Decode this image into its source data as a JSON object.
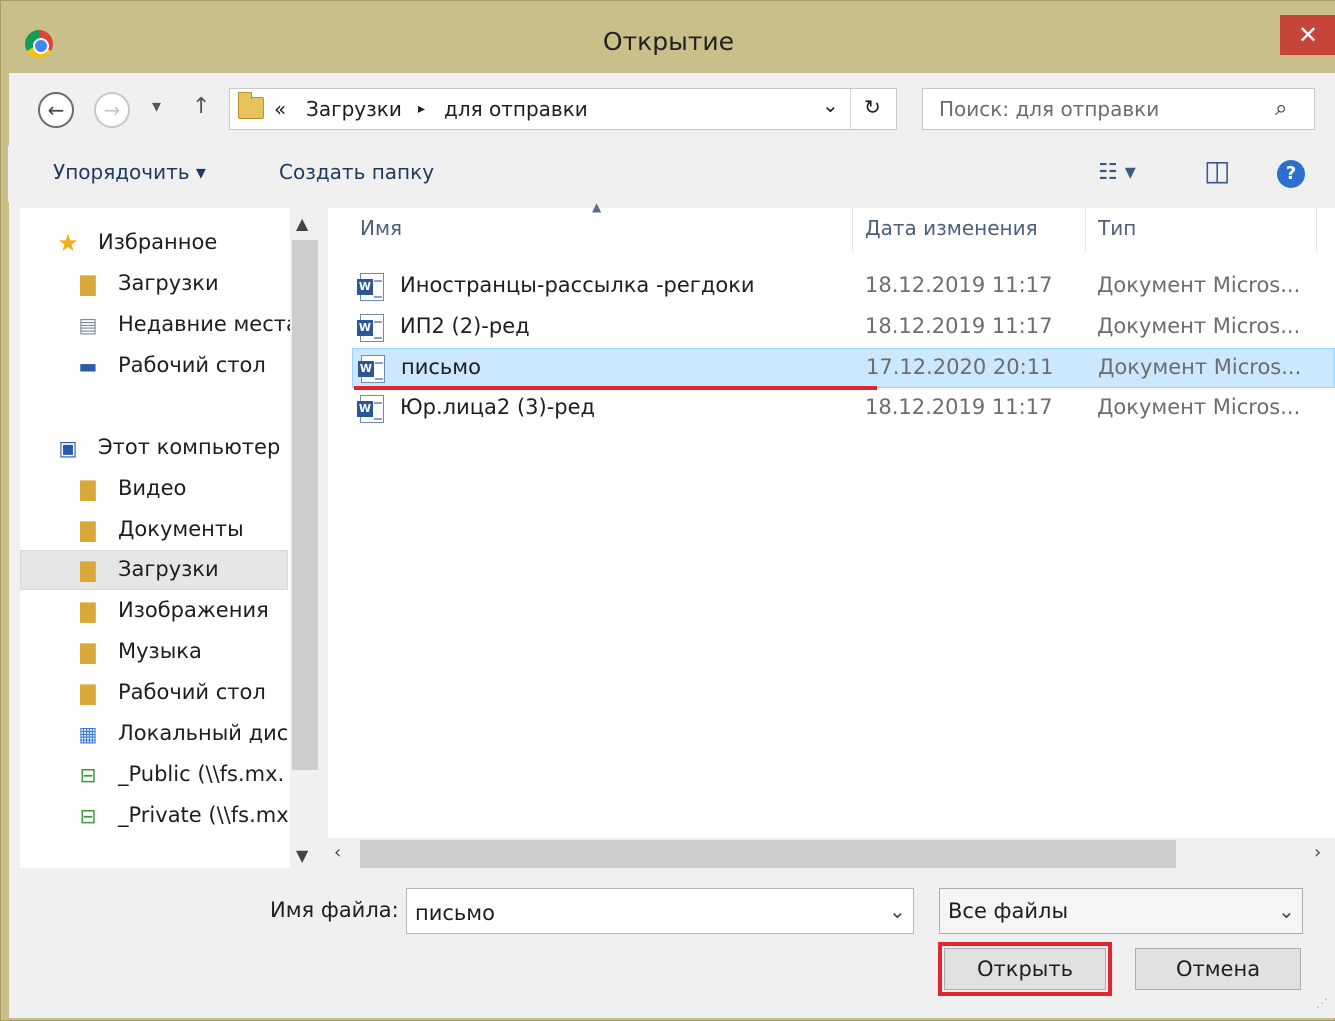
{
  "window": {
    "title": "Открытие",
    "close_glyph": "✕"
  },
  "nav": {
    "back_glyph": "←",
    "forward_glyph": "→",
    "recent_glyph": "▾",
    "up_glyph": "↑"
  },
  "address": {
    "overflow": "«",
    "crumbs": [
      "Загрузки",
      "для отправки"
    ],
    "crumb_sep": "▸",
    "dropdown_glyph": "⌄",
    "refresh_glyph": "↻"
  },
  "search": {
    "placeholder": "Поиск: для отправки",
    "icon_glyph": "⌕"
  },
  "toolbar": {
    "organize": "Упорядочить ▾",
    "new_folder": "Создать папку",
    "view_glyph": "☷ ▾",
    "preview_glyph": "◫",
    "help_glyph": "?"
  },
  "sidebar": {
    "favorites": {
      "label": "Избранное",
      "items": [
        "Загрузки",
        "Недавние места",
        "Рабочий стол"
      ]
    },
    "computer": {
      "label": "Этот компьютер",
      "items": [
        "Видео",
        "Документы",
        "Загрузки",
        "Изображения",
        "Музыка",
        "Рабочий стол",
        "Локальный диск",
        "_Public (\\\\fs.mx.",
        "_Private (\\\\fs.mx."
      ]
    }
  },
  "columns": {
    "name": "Имя",
    "date": "Дата изменения",
    "type": "Тип"
  },
  "files": [
    {
      "name": "Иностранцы-рассылка -регдоки",
      "date": "18.12.2019 11:17",
      "type": "Документ Micros..."
    },
    {
      "name": "ИП2 (2)-ред",
      "date": "18.12.2019 11:17",
      "type": "Документ Micros..."
    },
    {
      "name": "письмо",
      "date": "17.12.2020 20:11",
      "type": "Документ Micros..."
    },
    {
      "name": "Юр.лица2 (3)-ред",
      "date": "18.12.2019 11:17",
      "type": "Документ Micros..."
    }
  ],
  "selected_file_index": 2,
  "bottom": {
    "filename_label": "Имя файла:",
    "filename_value": "письмо",
    "filter_value": "Все файлы",
    "open_label": "Открыть",
    "cancel_label": "Отмена"
  },
  "colors": {
    "accent_red": "#e0262e",
    "selection": "#cce8ff",
    "titlebar": "#c9bf8a",
    "close": "#c7453b"
  }
}
